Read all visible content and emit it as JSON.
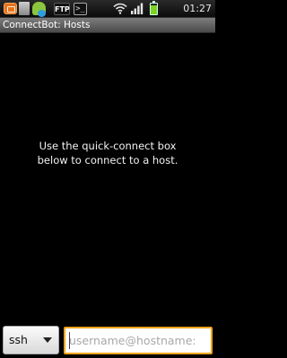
{
  "status_bar": {
    "ftp_label": "FTP",
    "terminal_label": ">_",
    "time": "01:27",
    "icons": [
      "notification-icon",
      "sd-card-icon",
      "android-icon",
      "ftp-icon",
      "terminal-icon",
      "wifi-icon",
      "signal-icon",
      "battery-icon"
    ]
  },
  "title_bar": {
    "title": "ConnectBot: Hosts"
  },
  "main": {
    "empty_line_1": "Use the quick-connect box",
    "empty_line_2": "below to connect to a host."
  },
  "quick_connect": {
    "protocol": "ssh",
    "host_value": "",
    "host_placeholder": "username@hostname:"
  },
  "colors": {
    "background": "#000000",
    "title_bar": "#5e5e5e",
    "input_focus_border": "#f0a218",
    "battery": "#7ed321"
  }
}
